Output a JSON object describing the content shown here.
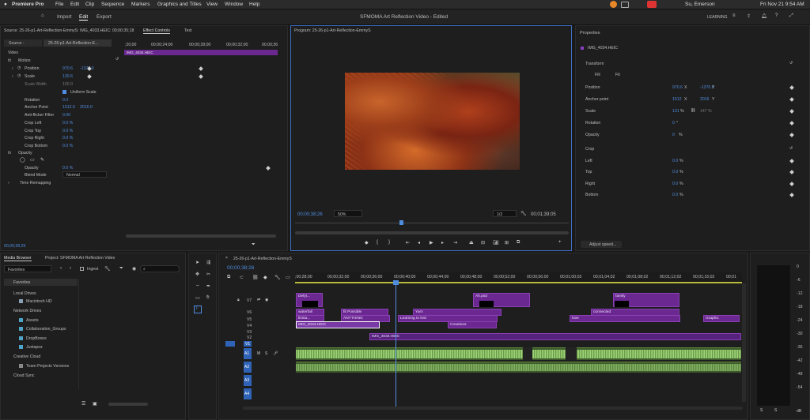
{
  "menubar": {
    "app": "Premiere Pro",
    "items": [
      "File",
      "Edit",
      "Clip",
      "Sequence",
      "Markers",
      "Graphics and Titles",
      "View",
      "Window",
      "Help"
    ],
    "user": "Su, Emerson",
    "datetime": "Fri Nov 21  9:54 AM"
  },
  "header": {
    "tabs": [
      "Import",
      "Edit",
      "Export"
    ],
    "title": "SFMOMA Art Reflection Video - Edited",
    "workspace": "LEARNING"
  },
  "effect_controls": {
    "source_line": "Source: 25-26-p1-Art-Reflection-EmmyS: IMG_4033.HEIC: 00;00;35;18",
    "tabs": [
      "Effect Controls",
      "Text"
    ],
    "subtabs": [
      "Source -",
      "25-26-p1-Art-Reflection-E..."
    ],
    "ruler": [
      ";20;00",
      "00;00;24;00",
      "00;00;28;00",
      "00;00;32;00",
      "00;00;36"
    ],
    "clip_label": "IMG_4034.HEIC",
    "section_video": "Video",
    "motion": "Motion",
    "rows": [
      {
        "name": "Position",
        "v1": "970.6",
        "v2": "-1370.0"
      },
      {
        "name": "Scale",
        "v1": "130.6",
        "v2": ""
      },
      {
        "name": "Scale Width",
        "v1": "100.0",
        "v2": ""
      },
      {
        "name": "Uniform Scale",
        "v1": "",
        "v2": ""
      },
      {
        "name": "Rotation",
        "v1": "0.0",
        "v2": ""
      },
      {
        "name": "Anchor Point",
        "v1": "1512.0",
        "v2": "2016.0"
      },
      {
        "name": "Anti-flicker Filter",
        "v1": "0.00",
        "v2": ""
      },
      {
        "name": "Crop Left",
        "v1": "0.0 %",
        "v2": ""
      },
      {
        "name": "Crop Top",
        "v1": "0.0 %",
        "v2": ""
      },
      {
        "name": "Crop Right",
        "v1": "0.0 %",
        "v2": ""
      },
      {
        "name": "Crop Bottom",
        "v1": "0.0 %",
        "v2": ""
      }
    ],
    "opacity": "Opacity",
    "opacity_row": {
      "name": "Opacity",
      "v1": "0.0 %"
    },
    "blend": {
      "name": "Blend Mode",
      "value": "Normal"
    },
    "time_remap": "Time Remapping",
    "timecode": "00;00;38;26"
  },
  "program": {
    "title": "Program: 25-26-p1-Art-Reflection-EmmyS",
    "timecode": "00;00;38;26",
    "zoom": "50%",
    "res": "1/2",
    "duration": "00;01;39;05"
  },
  "properties": {
    "title": "Properties",
    "clip": "IMG_4034.HEIC",
    "transform": "Transform",
    "fill": "Fill",
    "fit": "Fit",
    "rows": [
      {
        "name": "Position",
        "v1": "970.6",
        "u1": "X",
        "v2": "-1370.0",
        "u2": "Y"
      },
      {
        "name": "Anchor point",
        "v1": "1512",
        "u1": "X",
        "v2": "2016",
        "u2": "Y"
      },
      {
        "name": "Scale",
        "v1": "131",
        "u1": "%",
        "v2": "147",
        "u2": "%"
      },
      {
        "name": "Rotation",
        "v1": "0",
        "u1": "°",
        "v2": "",
        "u2": ""
      },
      {
        "name": "Opacity",
        "v1": "0",
        "u1": "%",
        "v2": "",
        "u2": ""
      }
    ],
    "crop": "Crop",
    "crop_rows": [
      {
        "name": "Left",
        "v": "0.0"
      },
      {
        "name": "Top",
        "v": "0.0"
      },
      {
        "name": "Right",
        "v": "0.0"
      },
      {
        "name": "Bottom",
        "v": "0.0"
      }
    ],
    "crop_unit": "%",
    "adjust": "Adjust speed..."
  },
  "media": {
    "tabs": [
      "Media Browser",
      "Project: SFMOMA Art Reflection Video"
    ],
    "dropdown": "Favorites",
    "ingest": "Ingest",
    "tree": [
      {
        "label": "Favorites",
        "indent": 0
      },
      {
        "label": "Local Drives",
        "indent": 0
      },
      {
        "label": "Macintosh HD",
        "indent": 1
      },
      {
        "label": "Network Drives",
        "indent": 0
      },
      {
        "label": "Assets",
        "indent": 1
      },
      {
        "label": "Collaboration_Groups",
        "indent": 1
      },
      {
        "label": "DropBoxes",
        "indent": 1
      },
      {
        "label": "Juxtapoz",
        "indent": 1
      },
      {
        "label": "Creative Cloud",
        "indent": 0
      },
      {
        "label": "Team Projects Versions",
        "indent": 1
      },
      {
        "label": "Cloud Sync",
        "indent": 0
      }
    ]
  },
  "timeline": {
    "tab": "25-26-p1-Art-Reflection-EmmyS",
    "timecode": "00;00;38;26",
    "ruler": [
      ";00;28;00",
      "00;00;32;00",
      "00;00;36;00",
      "00;00;40;00",
      "00;00;44;00",
      "00;00;48;00",
      "00;00;52;00",
      "00;00;56;00",
      "00;01;00;02",
      "00;01;04;02",
      "00;01;08;02",
      "00;01;12;02",
      "00;01;16;02",
      "00;01"
    ],
    "vtracks": [
      "V7",
      "V6",
      "V5",
      "V4",
      "V3",
      "V2",
      "V1"
    ],
    "atracks": [
      "A1",
      "A2",
      "A3",
      "A4"
    ],
    "clips": {
      "c1": "Defyi...",
      "c2": "Ah.psd",
      "c3": "family",
      "c4": "waterfall",
      "c5": "fit Possible",
      "c6": "Yarn",
      "c7": "connected",
      "c8": "limita...",
      "c9": "ANYTHING",
      "c10": "Learning to knit",
      "c11": "love",
      "c12": "Graphic",
      "c13": "IMG_4034.HEIC",
      "c14": "Creations",
      "c15": "IMG_4033.HEIC"
    }
  },
  "meter": {
    "scale": [
      "0",
      "-6",
      "-12",
      "-18",
      "-24",
      "-30",
      "-36",
      "-42",
      "-48",
      "-54"
    ],
    "db": "dB"
  }
}
